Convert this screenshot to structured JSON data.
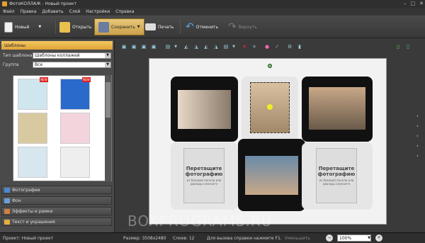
{
  "window": {
    "title": "ФотоКОЛЛАЖ - Новый проект"
  },
  "menu": [
    "Файл",
    "Правка",
    "Добавить",
    "Слой",
    "Настройки",
    "Справка"
  ],
  "toolbar": {
    "new": "Новый",
    "open": "Открыть",
    "save": "Сохранить",
    "print": "Печать",
    "undo": "Отменить",
    "redo": "Вернуть"
  },
  "left": {
    "header": "Шаблоны",
    "template_type_label": "Тип шаблона",
    "template_type_value": "Шаблоны коллажей",
    "group_label": "Группа",
    "group_value": "Все",
    "new_badge": "NEW",
    "accordion": [
      "Фотографии",
      "Фон",
      "Эффекты и рамки",
      "Текст и украшения"
    ]
  },
  "canvas": {
    "placeholder_title": "Перетащите фотографию",
    "placeholder_sub": "из боковой панели или дважды кликните"
  },
  "watermark": "BOXPROGRAMS.RU",
  "status": {
    "project": "Проект: Новый проект",
    "size": "Размер: 3508x2480",
    "layers": "Слоев: 12",
    "help": "Для вызова справки нажмите F1.",
    "shrink": "Уменьшить",
    "zoom": "100%"
  },
  "colors": {
    "accent": "#e8b84a",
    "panel": "#4a4a4a",
    "canvas": "#f2f2f2"
  }
}
